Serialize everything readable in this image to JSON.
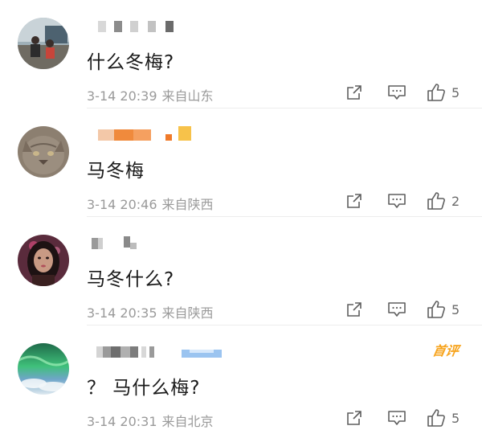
{
  "comments": [
    {
      "content": "什么冬梅?",
      "date": "3-14 20:39",
      "location": "来自山东",
      "likes": "5",
      "badge": "",
      "avatar": "avatar-people-outdoor"
    },
    {
      "content": "马冬梅",
      "date": "3-14 20:46",
      "location": "来自陕西",
      "likes": "2",
      "badge": "",
      "avatar": "avatar-cat"
    },
    {
      "content": "马冬什么?",
      "date": "3-14 20:35",
      "location": "来自陕西",
      "likes": "5",
      "badge": "",
      "avatar": "avatar-woman"
    },
    {
      "content": "？ 马什么梅?",
      "date": "3-14 20:31",
      "location": "来自北京",
      "likes": "5",
      "badge": "首评",
      "avatar": "avatar-aurora"
    }
  ],
  "icons": {
    "share": "share-icon",
    "reply": "reply-icon",
    "like": "thumbs-up-icon"
  },
  "colors": {
    "text": "#1a1a1a",
    "meta": "#9a9a9a",
    "badge": "#f7a31b"
  }
}
